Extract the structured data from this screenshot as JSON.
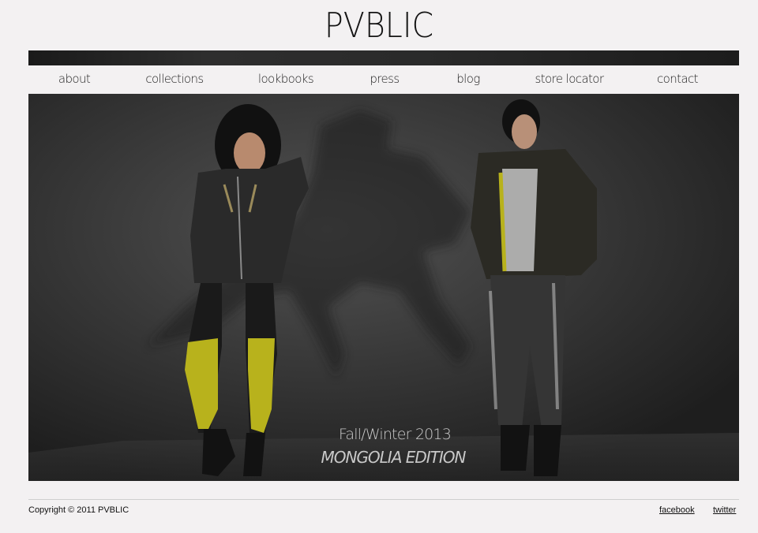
{
  "header": {
    "logo": "PVBLIC"
  },
  "nav": {
    "items": [
      {
        "label": "about"
      },
      {
        "label": "collections"
      },
      {
        "label": "lookbooks"
      },
      {
        "label": "press"
      },
      {
        "label": "blog"
      },
      {
        "label": "store locator"
      },
      {
        "label": "contact"
      }
    ]
  },
  "hero": {
    "caption_line1": "Fall/Winter 2013",
    "caption_line2": "MONGOLIA EDITION",
    "accent_color": "#c8c21e"
  },
  "footer": {
    "copyright": "Copyright © 2011 PVBLIC",
    "links": [
      {
        "label": "facebook"
      },
      {
        "label": "twitter"
      }
    ]
  }
}
